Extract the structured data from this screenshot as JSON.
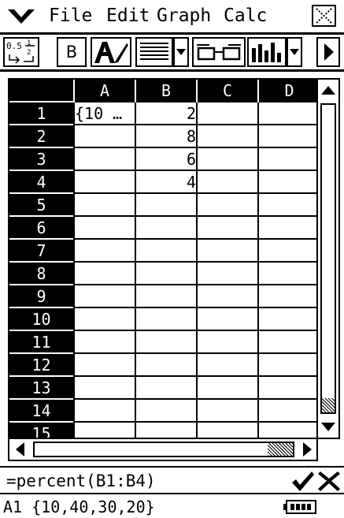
{
  "menu": {
    "items": [
      "File",
      "Edit",
      "Graph",
      "Calc"
    ]
  },
  "toolbar": {
    "bold_label": "B"
  },
  "sheet": {
    "columns": [
      "A",
      "B",
      "C",
      "D"
    ],
    "rows": [
      {
        "label": "1",
        "cells": [
          "{10 …",
          "2",
          "",
          ""
        ]
      },
      {
        "label": "2",
        "cells": [
          "",
          "8",
          "",
          ""
        ]
      },
      {
        "label": "3",
        "cells": [
          "",
          "6",
          "",
          ""
        ]
      },
      {
        "label": "4",
        "cells": [
          "",
          "4",
          "",
          ""
        ]
      },
      {
        "label": "5",
        "cells": [
          "",
          "",
          "",
          ""
        ]
      },
      {
        "label": "6",
        "cells": [
          "",
          "",
          "",
          ""
        ]
      },
      {
        "label": "7",
        "cells": [
          "",
          "",
          "",
          ""
        ]
      },
      {
        "label": "8",
        "cells": [
          "",
          "",
          "",
          ""
        ]
      },
      {
        "label": "9",
        "cells": [
          "",
          "",
          "",
          ""
        ]
      },
      {
        "label": "10",
        "cells": [
          "",
          "",
          "",
          ""
        ]
      },
      {
        "label": "11",
        "cells": [
          "",
          "",
          "",
          ""
        ]
      },
      {
        "label": "12",
        "cells": [
          "",
          "",
          "",
          ""
        ]
      },
      {
        "label": "13",
        "cells": [
          "",
          "",
          "",
          ""
        ]
      },
      {
        "label": "14",
        "cells": [
          "",
          "",
          "",
          ""
        ]
      },
      {
        "label": "15",
        "cells": [
          "",
          "",
          "",
          ""
        ]
      }
    ],
    "left_aligned_columns": [
      0
    ]
  },
  "entry": {
    "value": "=percent(B1:B4)"
  },
  "status": {
    "text": "A1 {10,40,30,20}"
  },
  "icons": {
    "menu": "chevron-down-icon",
    "close": "close-box-icon",
    "fraction_decimal": "fraction-decimal-icon",
    "format": "text-format-icon",
    "align": "align-lines-icon",
    "view": "glasses-icon",
    "graph": "bar-chart-icon",
    "ok": "checkmark-icon",
    "cancel": "cancel-x-icon",
    "battery": "battery-icon"
  },
  "colors": {
    "foreground": "#000000",
    "background": "#ffffff"
  }
}
